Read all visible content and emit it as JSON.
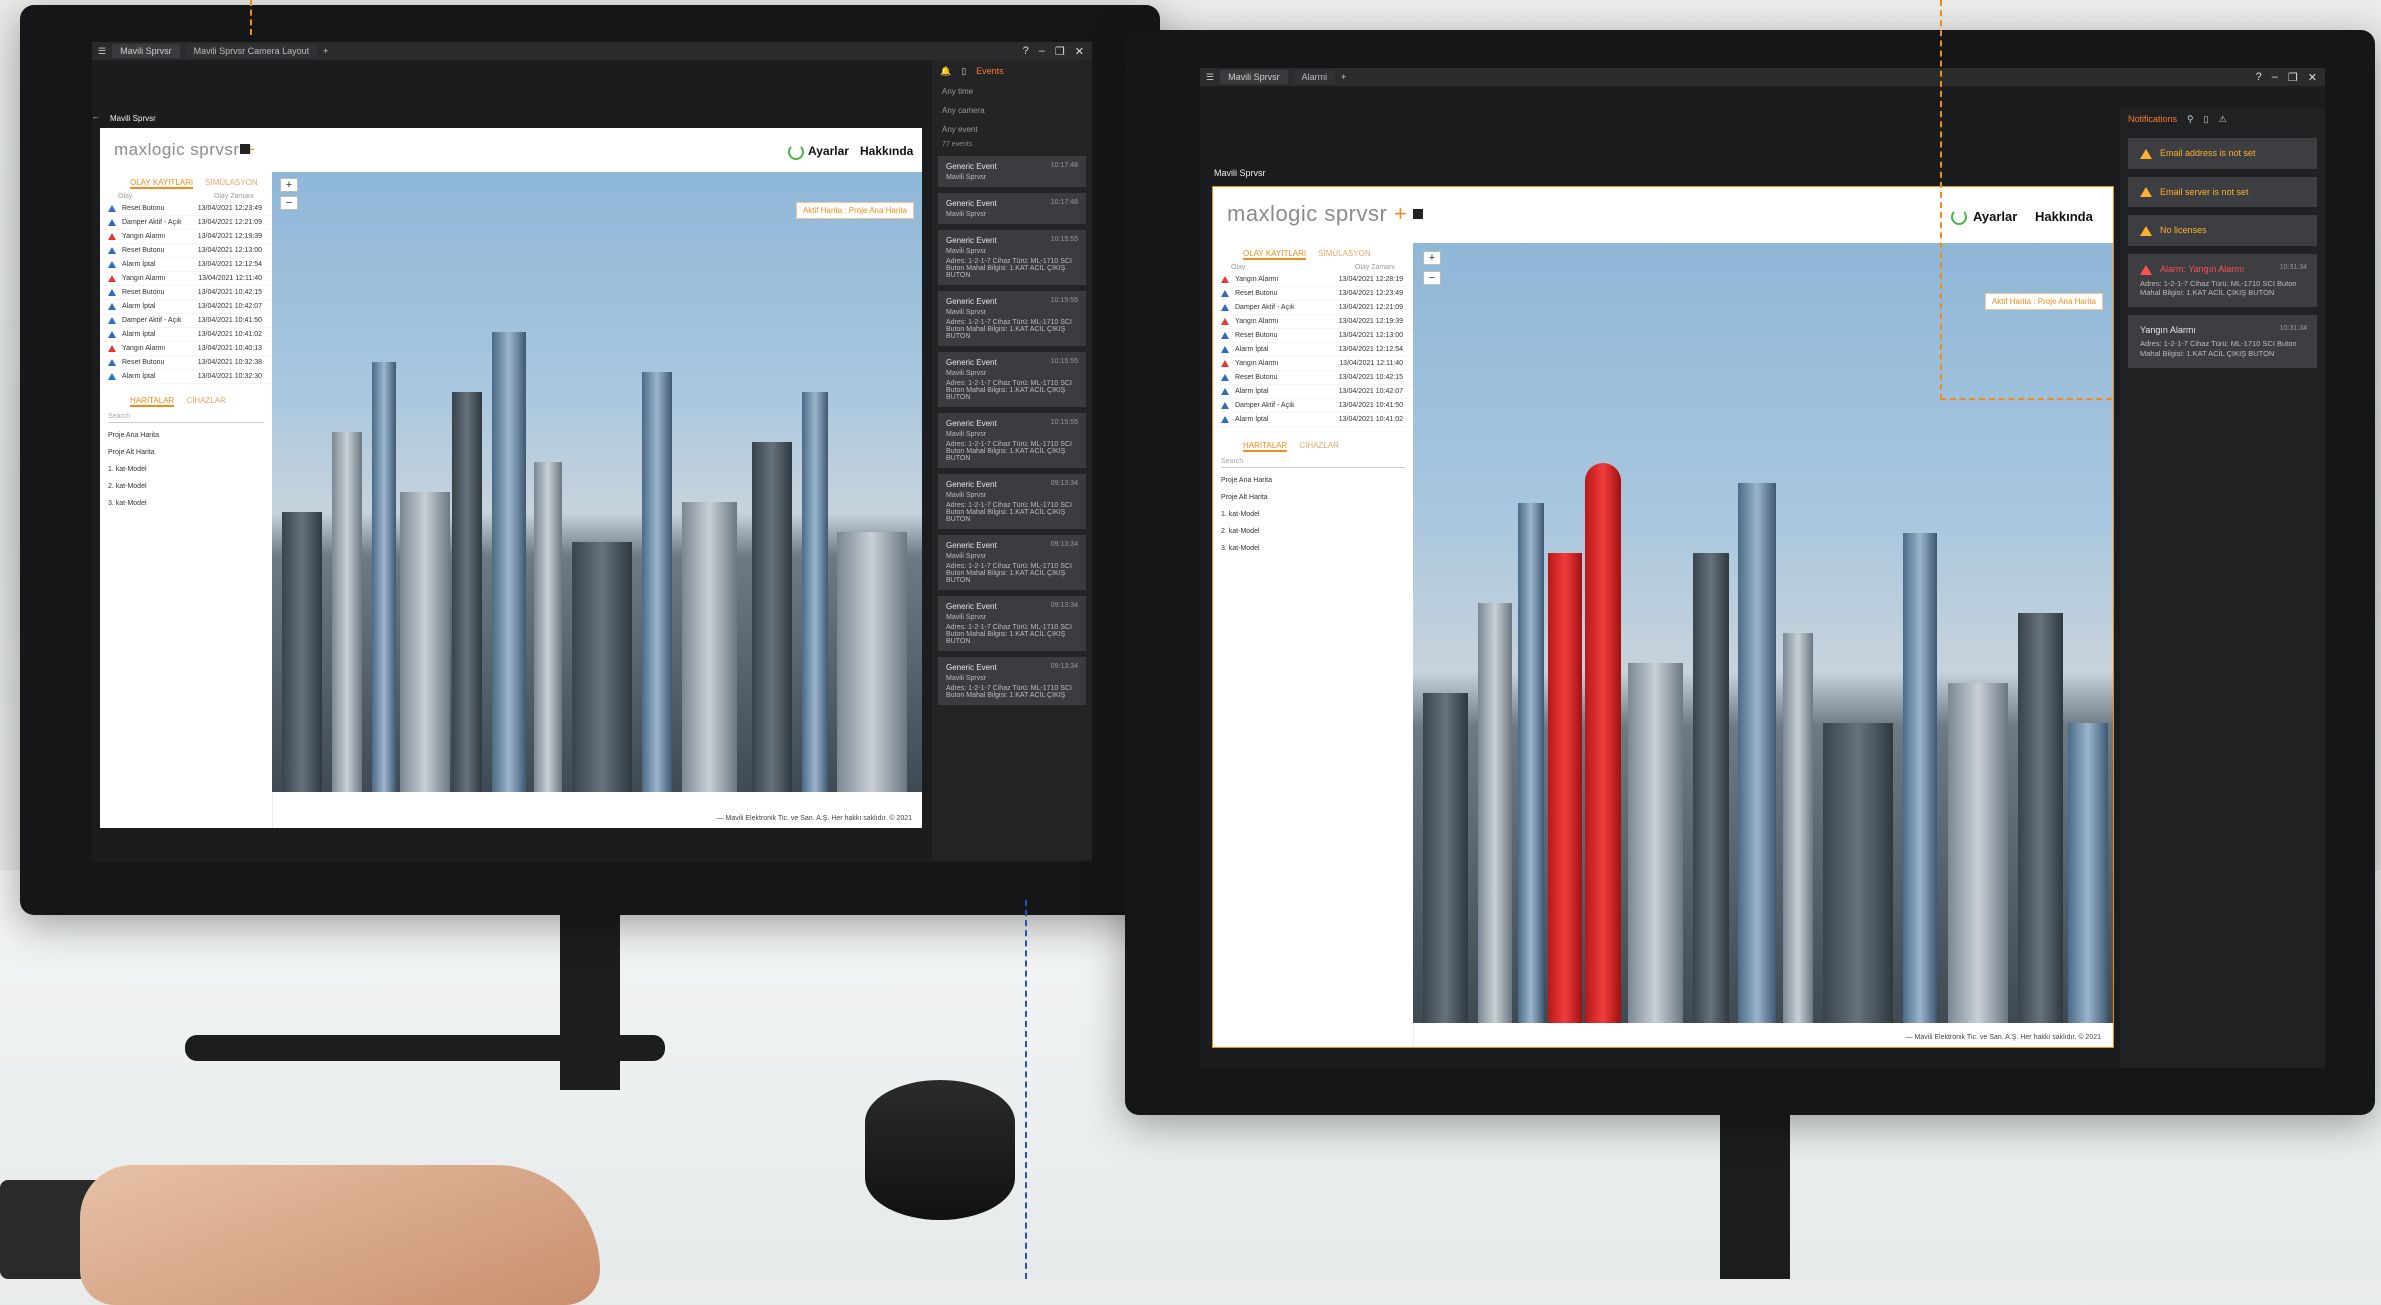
{
  "left": {
    "tabs": [
      "Mavili Sprvsr",
      "Mavili Sprvsr Camera Layout"
    ],
    "window_title": "Mavili Sprvsr",
    "logo_main": "maxlogic sprvsr",
    "logo_plus": "+",
    "menu": [
      "Ayarlar",
      "Hakkında"
    ],
    "panel_tabs": [
      "OLAY KAYITLARI",
      "SİMÜLASYON"
    ],
    "columns": [
      "Olay",
      "Olay Zamanı"
    ],
    "rows": [
      {
        "name": "Reset Butonu",
        "time": "13/04/2021 12:23:49",
        "color": "blue"
      },
      {
        "name": "Damper Aktif - Açık",
        "time": "13/04/2021 12:21:09",
        "color": "blue"
      },
      {
        "name": "Yangın Alarmı",
        "time": "13/04/2021 12:19:39",
        "color": "red"
      },
      {
        "name": "Reset Butonu",
        "time": "13/04/2021 12:13:00",
        "color": "blue"
      },
      {
        "name": "Alarm İptal",
        "time": "13/04/2021 12:12:54",
        "color": "blue"
      },
      {
        "name": "Yangın Alarmı",
        "time": "13/04/2021 12:11:40",
        "color": "red"
      },
      {
        "name": "Reset Butonu",
        "time": "13/04/2021 10:42:15",
        "color": "blue"
      },
      {
        "name": "Alarm İptal",
        "time": "13/04/2021 10:42:07",
        "color": "blue"
      },
      {
        "name": "Damper Aktif - Açık",
        "time": "13/04/2021 10:41:50",
        "color": "blue"
      },
      {
        "name": "Alarm İptal",
        "time": "13/04/2021 10:41:02",
        "color": "blue"
      },
      {
        "name": "Yangın Alarmı",
        "time": "13/04/2021 10:40:13",
        "color": "red"
      },
      {
        "name": "Reset Butonu",
        "time": "13/04/2021 10:32:38",
        "color": "blue"
      },
      {
        "name": "Alarm İptal",
        "time": "13/04/2021 10:32:30",
        "color": "blue"
      }
    ],
    "lower_tabs": [
      "HARİTALAR",
      "CİHAZLAR"
    ],
    "search": "Search",
    "maps": [
      "Proje Ana Harita",
      "Proje Alt Harita",
      "1. kat-Model",
      "2. kat-Model",
      "3. kat-Model"
    ],
    "badge": "Aktif Harita : Proje Ana Harita",
    "footer": "— Mavili Elektronik Tic. ve San. A.Ş. Her hakkı saklıdır. © 2021",
    "events": {
      "tabs": [
        "Events"
      ],
      "filters": [
        "Any time",
        "Any camera",
        "Any event"
      ],
      "count": "77 events",
      "cards": [
        {
          "title": "Generic Event",
          "source": "Mavili Sprvsr",
          "time": "10:17:48",
          "detail": ""
        },
        {
          "title": "Generic Event",
          "source": "Mavili Sprvsr",
          "time": "10:17:48",
          "detail": ""
        },
        {
          "title": "Generic Event",
          "source": "Mavili Sprvsr",
          "time": "10:15:55",
          "detail": "Adres: 1-2-1-7 Cihaz Türü: ML-1710 SCI Buton Mahal Bilgisi: 1.KAT ACİL ÇIKIŞ BUTON"
        },
        {
          "title": "Generic Event",
          "source": "Mavili Sprvsr",
          "time": "10:15:55",
          "detail": "Adres: 1-2-1-7 Cihaz Türü: ML-1710 SCI Buton Mahal Bilgisi: 1.KAT ACİL ÇIKIŞ BUTON"
        },
        {
          "title": "Generic Event",
          "source": "Mavili Sprvsr",
          "time": "10:15:55",
          "detail": "Adres: 1-2-1-7 Cihaz Türü: ML-1710 SCI Buton Mahal Bilgisi: 1.KAT ACİL ÇIKIŞ BUTON"
        },
        {
          "title": "Generic Event",
          "source": "Mavili Sprvsr",
          "time": "10:15:55",
          "detail": "Adres: 1-2-1-7 Cihaz Türü: ML-1710 SCI Buton Mahal Bilgisi: 1.KAT ACİL ÇIKIŞ BUTON"
        },
        {
          "title": "Generic Event",
          "source": "Mavili Sprvsr",
          "time": "09:13:34",
          "detail": "Adres: 1-2-1-7 Cihaz Türü: ML-1710 SCI Buton Mahal Bilgisi: 1.KAT ACİL ÇIKIŞ BUTON"
        },
        {
          "title": "Generic Event",
          "source": "Mavili Sprvsr",
          "time": "09:13:34",
          "detail": "Adres: 1-2-1-7 Cihaz Türü: ML-1710 SCI Buton Mahal Bilgisi: 1.KAT ACİL ÇIKIŞ BUTON"
        },
        {
          "title": "Generic Event",
          "source": "Mavili Sprvsr",
          "time": "09:13:34",
          "detail": "Adres: 1-2-1-7 Cihaz Türü: ML-1710 SCI Buton Mahal Bilgisi: 1.KAT ACİL ÇIKIŞ BUTON"
        },
        {
          "title": "Generic Event",
          "source": "Mavili Sprvsr",
          "time": "09:13:34",
          "detail": "Adres: 1-2-1-7 Cihaz Türü: ML-1710 SCI Buton Mahal Bilgisi: 1.KAT ACİL ÇIKIŞ"
        }
      ]
    }
  },
  "right": {
    "tabs": [
      "Mavili Sprvsr",
      "Alarmi"
    ],
    "window_title": "Mavili Sprvsr",
    "logo_main": "maxlogic sprvsr",
    "logo_plus": "+",
    "menu": [
      "Ayarlar",
      "Hakkında"
    ],
    "panel_tabs": [
      "OLAY KAYITLARI",
      "SİMÜLASYON"
    ],
    "columns": [
      "Olay",
      "Olay Zamanı"
    ],
    "rows": [
      {
        "name": "Yangın Alarmı",
        "time": "13/04/2021 12:28:19",
        "color": "red"
      },
      {
        "name": "Reset Butonu",
        "time": "13/04/2021 12:23:49",
        "color": "blue"
      },
      {
        "name": "Damper Aktif - Açık",
        "time": "13/04/2021 12:21:09",
        "color": "blue"
      },
      {
        "name": "Yangın Alarmı",
        "time": "13/04/2021 12:19:39",
        "color": "red"
      },
      {
        "name": "Reset Butonu",
        "time": "13/04/2021 12:13:00",
        "color": "blue"
      },
      {
        "name": "Alarm İptal",
        "time": "13/04/2021 12:12:54",
        "color": "blue"
      },
      {
        "name": "Yangın Alarmı",
        "time": "13/04/2021 12:11:40",
        "color": "red"
      },
      {
        "name": "Reset Butonu",
        "time": "13/04/2021 10:42:15",
        "color": "blue"
      },
      {
        "name": "Alarm İptal",
        "time": "13/04/2021 10:42:07",
        "color": "blue"
      },
      {
        "name": "Damper Aktif - Açık",
        "time": "13/04/2021 10:41:50",
        "color": "blue"
      },
      {
        "name": "Alarm İptal",
        "time": "13/04/2021 10:41:02",
        "color": "blue"
      }
    ],
    "lower_tabs": [
      "HARİTALAR",
      "CİHAZLAR"
    ],
    "search": "Search",
    "maps": [
      "Proje Ana Harita",
      "Proje Alt Harita",
      "1. kat-Model",
      "2. kat-Model",
      "3. kat-Model"
    ],
    "badge": "Aktif Harita : Proje Ana Harita",
    "footer": "— Mavili Elektronik Tic. ve San. A.Ş. Her hakkı saklıdır. © 2021",
    "notifications": {
      "title": "Notifications",
      "items": [
        {
          "text": "Email address is not set",
          "type": "warn",
          "time": "",
          "detail": ""
        },
        {
          "text": "Email server is not set",
          "type": "warn",
          "time": "",
          "detail": ""
        },
        {
          "text": "No licenses",
          "type": "warn",
          "time": "",
          "detail": ""
        },
        {
          "text": "Alarm: Yangın Alarmı",
          "type": "err",
          "time": "10:31:34",
          "detail": "Adres: 1-2-1-7 Cihaz Türü: ML-1710 SCI Buton Mahal Bilgisi: 1.KAT ACİL ÇIKIŞ BUTON"
        },
        {
          "text": "Yangın Alarmı",
          "type": "plain",
          "time": "10:31:34",
          "detail": "Adres: 1-2-1-7 Cihaz Türü: ML-1710 SCI Buton Mahal Bilgisi: 1.KAT ACİL ÇIKIŞ BUTON"
        }
      ]
    }
  },
  "colors": {
    "accent": "#f08c1a",
    "alarm_red": "#e53935",
    "info_blue": "#2d6cc0",
    "power_green": "#49b649"
  }
}
